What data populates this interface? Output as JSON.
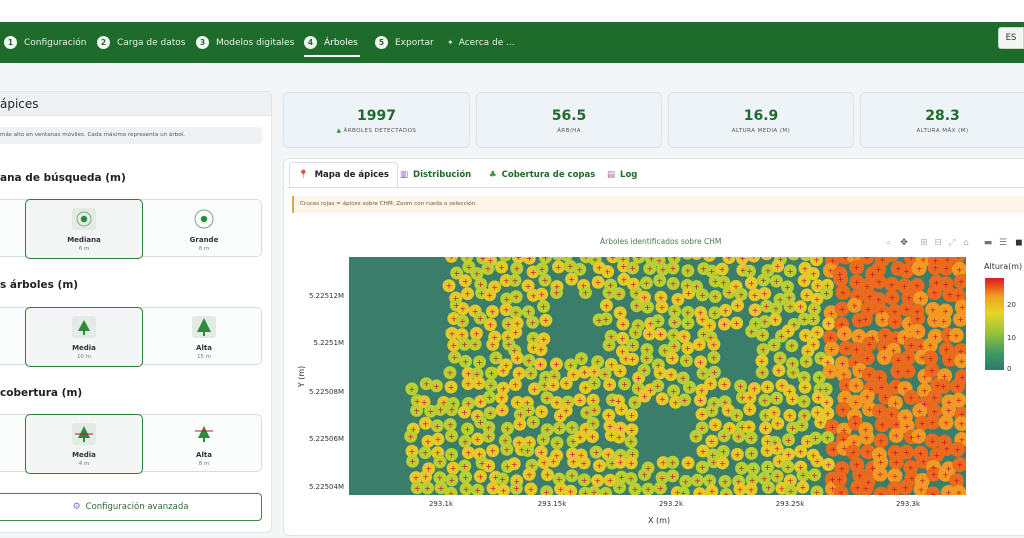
{
  "nav": {
    "items": [
      {
        "num": "1",
        "label": "Configuración"
      },
      {
        "num": "2",
        "label": "Carga de datos"
      },
      {
        "num": "3",
        "label": "Modelos digitales"
      },
      {
        "num": "4",
        "label": "Árboles"
      },
      {
        "num": "5",
        "label": "Exportar"
      }
    ],
    "about_label": "Acerca de ...",
    "lang": "ES"
  },
  "left": {
    "title": "ápices",
    "note": "más alto en ventanas móviles. Cada máximo representa un árbol.",
    "sections": [
      {
        "title": "ana de búsqueda (m)",
        "options": [
          {
            "label": "Mediana",
            "sub": "6 m"
          },
          {
            "label": "Grande",
            "sub": "8 m"
          }
        ]
      },
      {
        "title": "s árboles (m)",
        "options": [
          {
            "label": "Media",
            "sub": "10 m"
          },
          {
            "label": "Alta",
            "sub": "15 m"
          }
        ]
      },
      {
        "title": "cobertura (m)",
        "options": [
          {
            "label": "Media",
            "sub": "4 m"
          },
          {
            "label": "Alta",
            "sub": "8 m"
          }
        ]
      }
    ],
    "advanced_label": "Configuración avanzada"
  },
  "stats": [
    {
      "value": "1997",
      "label": "ÁRBOLES DETECTADOS"
    },
    {
      "value": "56.5",
      "label": "ÁRB/HA"
    },
    {
      "value": "16.9",
      "label": "ALTURA MEDIA (M)"
    },
    {
      "value": "28.3",
      "label": "ALTURA MÁX (M)"
    }
  ],
  "tabs": [
    {
      "label": "Mapa de ápices",
      "icon": "pin-icon"
    },
    {
      "label": "Distribución",
      "icon": "bar-chart-icon"
    },
    {
      "label": "Cobertura de copas",
      "icon": "tree-icon"
    },
    {
      "label": "Log",
      "icon": "notepad-icon"
    }
  ],
  "hint": "Cruces rojas = ápices sobre CHM. Zoom con rueda o selección.",
  "chart_data": {
    "type": "heatmap",
    "title": "Árboles identificados sobre CHM",
    "xlabel": "X (m)",
    "ylabel": "Y (m)",
    "x_ticks": [
      "293.1k",
      "293.15k",
      "293.2k",
      "293.25k",
      "293.3k"
    ],
    "y_ticks": [
      "5.22512M",
      "5.2251M",
      "5.22508M",
      "5.22506M",
      "5.22504M"
    ],
    "colorbar_title": "Altura(m)",
    "colorbar_ticks": [
      "20",
      "10",
      "0"
    ],
    "colors": {
      "low": "#2e7a6b",
      "mid": "#e6d428",
      "high": "#d81f1f",
      "marker": "#c8102e"
    }
  }
}
